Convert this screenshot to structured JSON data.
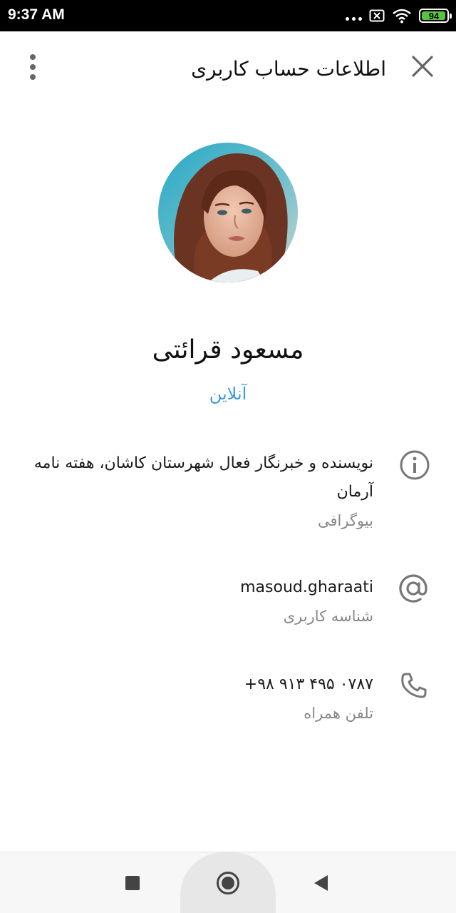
{
  "status_bar": {
    "time": "9:37 AM",
    "battery_level": "94",
    "icons": [
      "more-dots-icon",
      "sim-icon",
      "wifi-icon",
      "battery-icon"
    ]
  },
  "header": {
    "title": "اطلاعات حساب کاربری",
    "close_icon": "close-icon",
    "menu_icon": "more-vert-icon"
  },
  "profile": {
    "name": "مسعود قرائتی",
    "status": "آنلاین"
  },
  "info": {
    "bio": {
      "icon": "info-icon",
      "line1": "نویسنده و خبرنگار فعال شهرستان کاشان، هفته نامه",
      "line2": "آرمان",
      "label": "بیوگرافی"
    },
    "username": {
      "icon": "at-icon",
      "value": "masoud.gharaati",
      "label": "شناسه کاربری"
    },
    "phone": {
      "icon": "phone-icon",
      "value": "+۹۸ ۹۱۳ ۴۹۵ ۰۷۸۷",
      "label": "تلفن همراه"
    }
  },
  "nav_bar": {
    "icons": [
      "recents-square-icon",
      "home-circle-icon",
      "back-triangle-icon"
    ]
  },
  "colors": {
    "accent": "#3a9ae0",
    "battery": "#5ac43c",
    "icon_gray": "#777777"
  }
}
